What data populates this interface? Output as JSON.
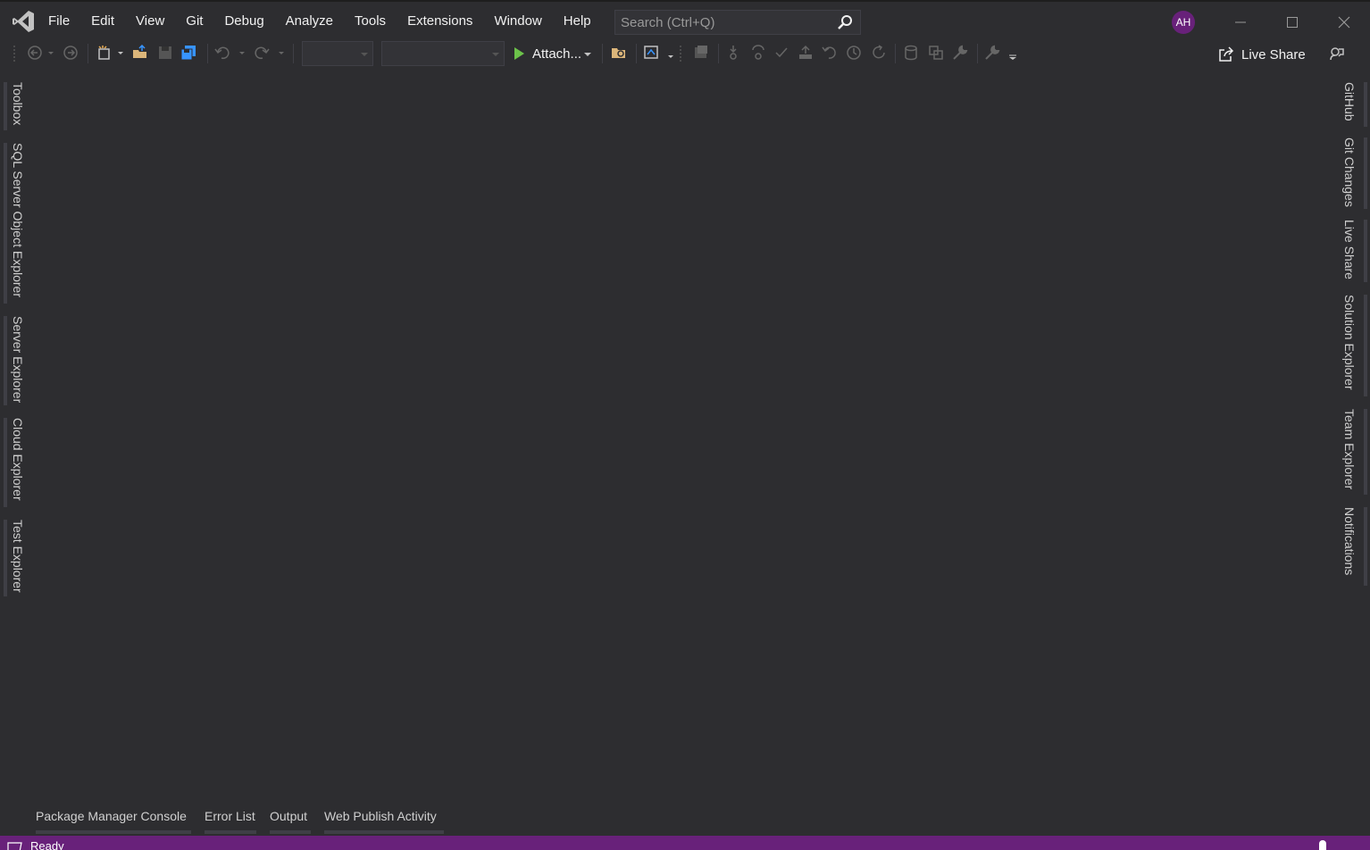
{
  "menu": [
    "File",
    "Edit",
    "View",
    "Git",
    "Debug",
    "Analyze",
    "Tools",
    "Extensions",
    "Window",
    "Help"
  ],
  "search": {
    "placeholder": "Search (Ctrl+Q)"
  },
  "account": {
    "initials": "AH",
    "color": "#68217a"
  },
  "toolbar": {
    "attach_label": "Attach...",
    "live_share_label": "Live Share"
  },
  "left_tabs": [
    "Toolbox",
    "SQL Server Object Explorer",
    "Server Explorer",
    "Cloud Explorer",
    "Test Explorer"
  ],
  "right_tabs": [
    "GitHub",
    "Git Changes",
    "Live Share",
    "Solution Explorer",
    "Team Explorer",
    "Notifications"
  ],
  "bottom_tabs": [
    "Package Manager Console",
    "Error List",
    "Output",
    "Web Publish Activity"
  ],
  "status": {
    "text": "Ready"
  },
  "colors": {
    "background": "#2d2d30",
    "accent": "#68217a",
    "play": "#6cc24a"
  }
}
